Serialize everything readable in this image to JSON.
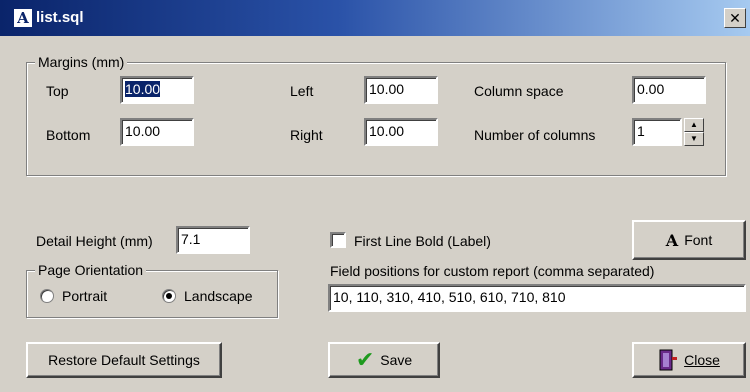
{
  "window": {
    "title": "list.sql",
    "close_glyph": "✕"
  },
  "margins": {
    "legend": "Margins (mm)",
    "top_label": "Top",
    "top_value": "10.00",
    "bottom_label": "Bottom",
    "bottom_value": "10.00",
    "left_label": "Left",
    "left_value": "10.00",
    "right_label": "Right",
    "right_value": "10.00",
    "column_space_label": "Column space",
    "column_space_value": "0.00",
    "columns_label": "Number of columns",
    "columns_value": "1"
  },
  "detail": {
    "label": "Detail Height (mm)",
    "value": "7.1"
  },
  "first_line_bold": {
    "label": "First Line Bold (Label)",
    "checked": false
  },
  "font_button": {
    "label": "Font",
    "icon": "font-a-icon"
  },
  "orientation": {
    "legend": "Page Orientation",
    "portrait_label": "Portrait",
    "landscape_label": "Landscape",
    "selected": "Landscape"
  },
  "field_positions": {
    "label": "Field positions for custom report (comma separated)",
    "value": "10, 110, 310, 410, 510, 610, 710, 810"
  },
  "buttons": {
    "restore_label": "Restore Default Settings",
    "save_label": "Save",
    "close_label": "Close"
  },
  "colors": {
    "titlebar_start": "#0a246a",
    "titlebar_end": "#a6caf0",
    "face": "#d4d0c8",
    "save_check": "#1e9a1e"
  }
}
